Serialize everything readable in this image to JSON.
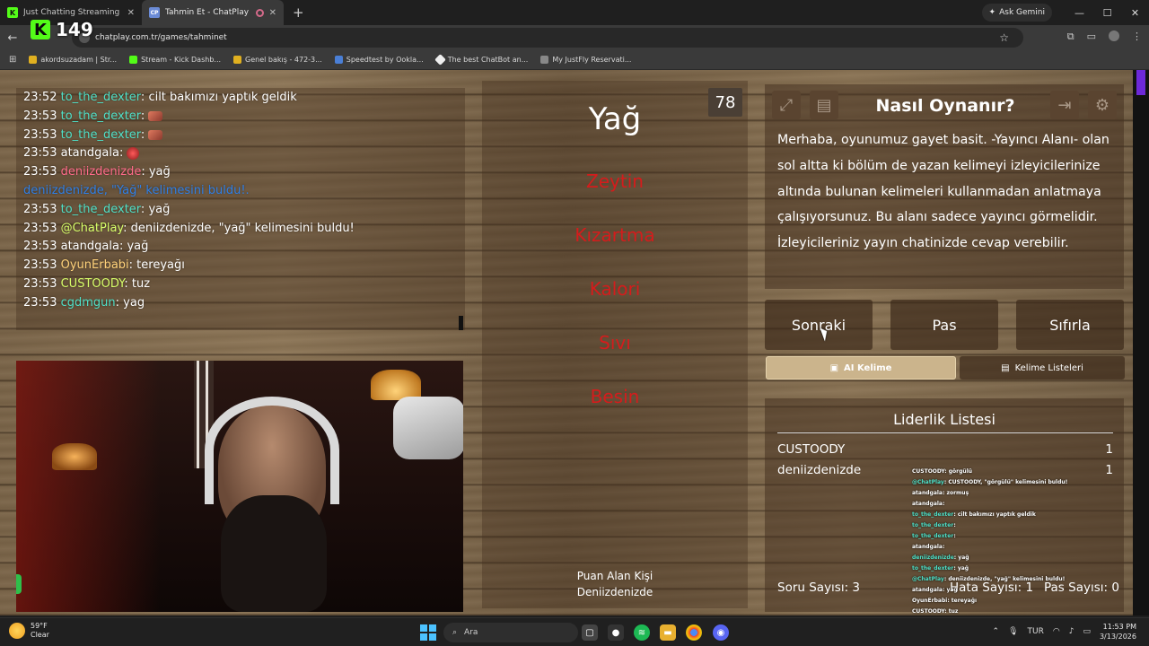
{
  "browser": {
    "tabs": [
      {
        "title": "Just Chatting Streaming - Live",
        "active": false
      },
      {
        "title": "Tahmin Et - ChatPlay",
        "active": true
      }
    ],
    "gemini_label": "Ask Gemini",
    "url": "chatplay.com.tr/games/tahminet",
    "bookmarks": [
      "akordsuzadam | Str...",
      "Stream - Kick Dashb...",
      "Genel bakış - 472-3...",
      "Speedtest by Ookla...",
      "The best ChatBot an...",
      "My JustFly Reservati..."
    ],
    "kick_viewers": "149"
  },
  "chat": {
    "lines": [
      {
        "time": "23:52",
        "user": "to_the_dexter",
        "color": "cyan",
        "msg": "cilt bakımızı yaptık geldik"
      },
      {
        "time": "23:53",
        "user": "to_the_dexter",
        "color": "cyan",
        "msg": "",
        "emote": true
      },
      {
        "time": "23:53",
        "user": "to_the_dexter",
        "color": "cyan",
        "msg": "",
        "emote": true
      },
      {
        "time": "23:53",
        "user": "atandgala",
        "color": "white",
        "msg": "",
        "emote": true
      },
      {
        "time": "23:53",
        "user": "deniizdenizde",
        "color": "pink",
        "msg": "yağ"
      },
      {
        "system": "deniizdenizde, \"Yağ\" kelimesini buldu!."
      },
      {
        "time": "23:53",
        "user": "to_the_dexter",
        "color": "cyan",
        "msg": "yağ"
      },
      {
        "time": "23:53",
        "user": "@ChatPlay",
        "color": "lime",
        "msg": "deniizdenizde, \"yağ\" kelimesini buldu!"
      },
      {
        "time": "23:53",
        "user": "atandgala",
        "color": "white",
        "msg": "yağ"
      },
      {
        "time": "23:53",
        "user": "OyunErbabi",
        "color": "gold",
        "msg": "tereyağı"
      },
      {
        "time": "23:53",
        "user": "CUSTOODY",
        "color": "lime",
        "msg": "tuz"
      },
      {
        "time": "23:53",
        "user": "cgdmgun",
        "color": "cyan",
        "msg": "yag"
      }
    ]
  },
  "game": {
    "timer": "78",
    "word": "Yağ",
    "taboo": [
      "Zeytin",
      "Kızartma",
      "Kalori",
      "Sıvı",
      "Besin"
    ],
    "scorer_label": "Puan Alan Kişi",
    "scorer_name": "Deniizdenizde"
  },
  "howto": {
    "title": "Nasıl Oynanır?",
    "text": "Merhaba, oyunumuz gayet basit. -Yayıncı Alanı- olan sol altta ki bölüm de yazan kelimeyi izleyicilerinize altında bulunan kelimeleri kullanmadan anlatmaya çalışıyorsunuz. Bu alanı sadece yayıncı görmelidir. İzleyicileriniz yayın chatinizde cevap verebilir."
  },
  "buttons": {
    "next": "Sonraki",
    "pass": "Pas",
    "reset": "Sıfırla"
  },
  "tabs": {
    "ai": "AI Kelime",
    "lists": "Kelime Listeleri"
  },
  "leaderboard": {
    "title": "Liderlik Listesi",
    "rows": [
      {
        "name": "CUSTOODY",
        "score": "1"
      },
      {
        "name": "deniizdenizde",
        "score": "1"
      }
    ],
    "question_count": "Soru Sayısı: 3",
    "error_count": "Hata Sayısı: 1",
    "pass_count": "Pas Sayısı: 0"
  },
  "overlay_chat": [
    {
      "user": "CUSTOODY",
      "msg": ": görgülü"
    },
    {
      "user": "@ChatPlay",
      "msg": ": CUSTOODY, \"görgülü\" kelimesini buldu!"
    },
    {
      "user": "atandgala",
      "msg": ": zormuş"
    },
    {
      "user": "atandgala",
      "msg": ":"
    },
    {
      "user": "to_the_dexter",
      "msg": ": cilt bakımızı yaptık geldik"
    },
    {
      "user": "to_the_dexter",
      "msg": ":"
    },
    {
      "user": "to_the_dexter",
      "msg": ":"
    },
    {
      "user": "atandgala",
      "msg": ":"
    },
    {
      "user": "deniizdenizde",
      "msg": ": yağ"
    },
    {
      "user": "to_the_dexter",
      "msg": ": yağ"
    },
    {
      "user": "@ChatPlay",
      "msg": ": deniizdenizde, \"yağ\" kelimesini buldu!"
    },
    {
      "user": "atandgala",
      "msg": ": yağ"
    },
    {
      "user": "OyunErbabi",
      "msg": ": tereyağı"
    },
    {
      "user": "CUSTOODY",
      "msg": ": tuz"
    },
    {
      "user": "cgdmgun",
      "msg": ": yag"
    }
  ],
  "taskbar": {
    "temp": "59°F",
    "weather": "Clear",
    "search": "Ara",
    "lang": "TUR",
    "time": "11:53 PM",
    "date": "3/13/2026"
  }
}
